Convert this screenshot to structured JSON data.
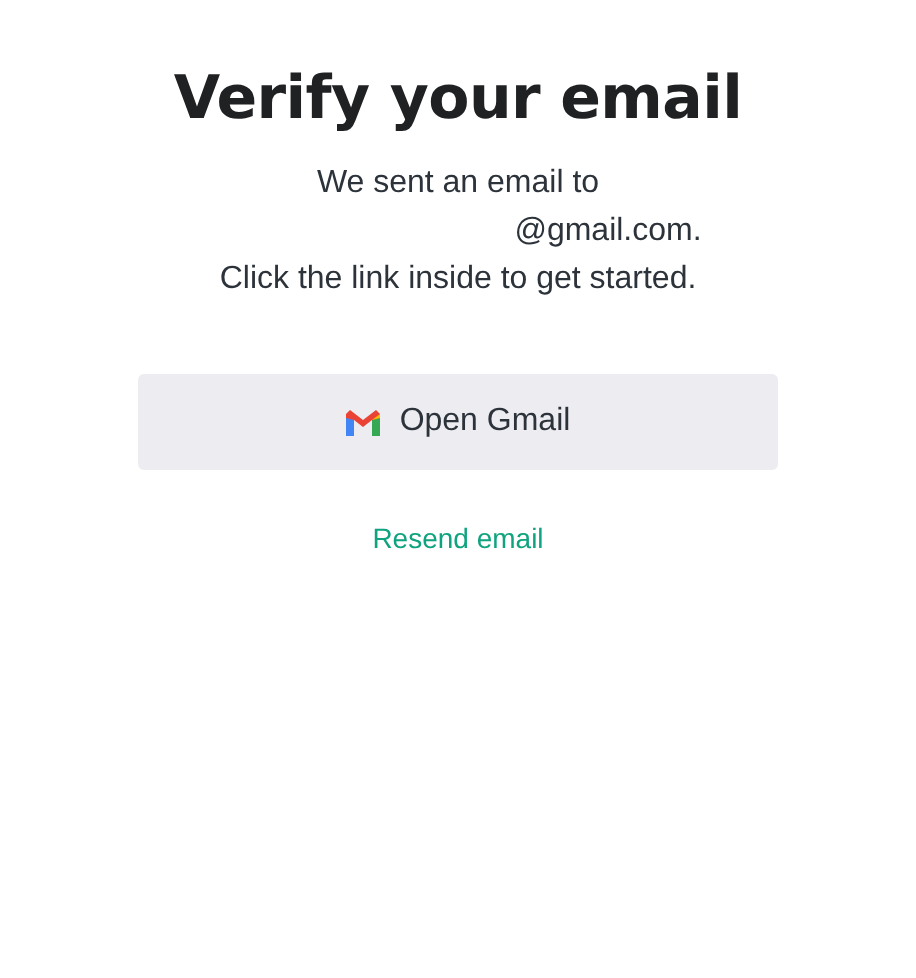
{
  "title": "Verify your email",
  "message_lines": [
    "We sent an email to",
    "@gmail.com.",
    "Click the link inside to get started."
  ],
  "primary_button": {
    "label": "Open Gmail"
  },
  "link": {
    "label": "Resend email"
  }
}
